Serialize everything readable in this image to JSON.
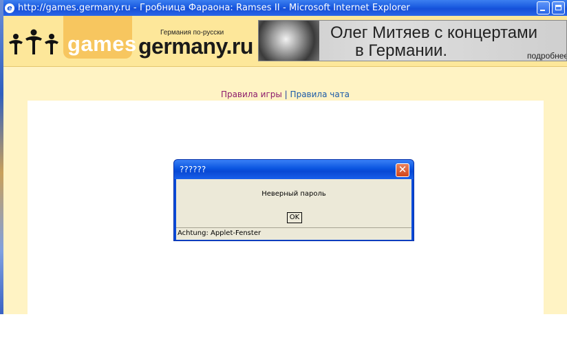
{
  "window": {
    "title": "http://games.germany.ru - Гробница Фараона: Ramses II - Microsoft Internet Explorer",
    "icon": "ie-icon"
  },
  "header": {
    "games_tab": "games",
    "site_subtitle": "Германия по-русски",
    "site_name": "germany.ru",
    "banner": {
      "line1": "Олег Митяев с концертами",
      "line2": "в Германии.",
      "more": "подробнее"
    }
  },
  "links": {
    "game_rules": "Правила игры",
    "separator": "|",
    "chat_rules": "Правила чата"
  },
  "dialog": {
    "title": "??????",
    "message": "Неверный пароль",
    "ok_label": "OK",
    "status": "Achtung: Applet-Fenster"
  },
  "colors": {
    "titlebar": "#1a5be0",
    "page_background": "#fff3c4",
    "header_background": "#fde79a",
    "games_tab": "#f7c65f",
    "link_game": "#8b1a6b",
    "link_chat": "#1a5aa8",
    "dialog_body": "#ece9d8"
  }
}
